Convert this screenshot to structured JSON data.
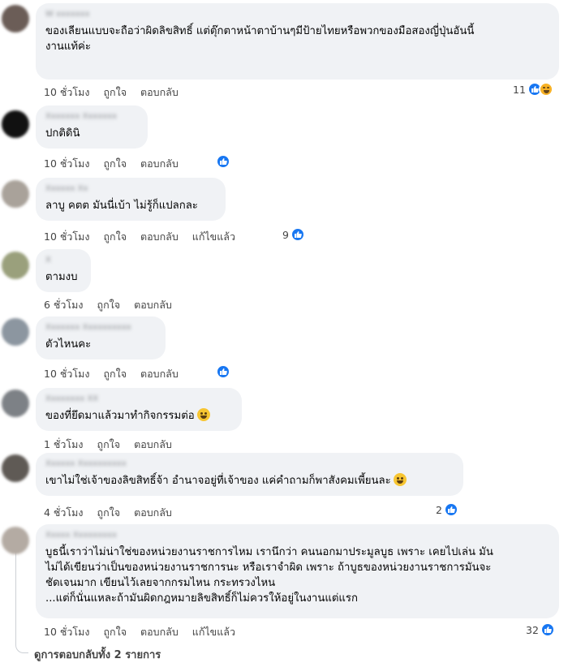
{
  "comments": [
    {
      "author": "W xxxxxxx",
      "lines": [
        "ของเลียนแบบจะถือว่าผิดลิขสิทธิ์ แต่ตุ๊กตาหน้าตาบ้านๆมีป้ายไทยหรือพวกของมือสองญี่ปุ่นอันนี้",
        "งานแท้ค่ะ"
      ],
      "time": "10 ชั่วโมง",
      "like": "ถูกใจ",
      "reply": "ตอบกลับ",
      "edited": "",
      "reaction_count": "11",
      "reactions": [
        "like",
        "haha"
      ],
      "emoji": ""
    },
    {
      "author": "Xxxxxxx Xxxxxxx",
      "lines": [
        "ปกติดินิ"
      ],
      "time": "10 ชั่วโมง",
      "like": "ถูกใจ",
      "reply": "ตอบกลับ",
      "edited": "",
      "reaction_count": "",
      "reactions": [
        "like"
      ],
      "emoji": ""
    },
    {
      "author": "Xxxxxx Xx",
      "lines": [
        "ลาบู คตต มันนี่เบ้า ไม่รู้ก็แปลกละ"
      ],
      "time": "10 ชั่วโมง",
      "like": "ถูกใจ",
      "reply": "ตอบกลับ",
      "edited": "แก้ไขแล้ว",
      "reaction_count": "9",
      "reactions": [
        "like"
      ],
      "emoji": ""
    },
    {
      "author": "X",
      "lines": [
        "ตามงบ"
      ],
      "time": "6 ชั่วโมง",
      "like": "ถูกใจ",
      "reply": "ตอบกลับ",
      "edited": "",
      "reaction_count": "",
      "reactions": [],
      "emoji": ""
    },
    {
      "author": "Xxxxxxx Xxxxxxxxxx",
      "lines": [
        "ตัวไหนคะ"
      ],
      "time": "10 ชั่วโมง",
      "like": "ถูกใจ",
      "reply": "ตอบกลับ",
      "edited": "",
      "reaction_count": "",
      "reactions": [
        "like"
      ],
      "emoji": ""
    },
    {
      "author": "Xxxxxxxx XX",
      "lines": [
        "ของที่ยึดมาแล้วมาทำกิจกรรมต่อ"
      ],
      "time": "1 ชั่วโมง",
      "like": "ถูกใจ",
      "reply": "ตอบกลับ",
      "edited": "",
      "reaction_count": "",
      "reactions": [],
      "emoji": "grin"
    },
    {
      "author": "Xxxxxx Xxxxxxxxxx",
      "lines": [
        "เขาไม่ใช่เจ้าของลิขสิทธิ์จ้า อำนาจอยู่ที่เจ้าของ แค่คำถามก็พาสังคมเพี้ยนละ"
      ],
      "time": "4 ชั่วโมง",
      "like": "ถูกใจ",
      "reply": "ตอบกลับ",
      "edited": "",
      "reaction_count": "2",
      "reactions": [
        "like"
      ],
      "emoji": "laugh"
    },
    {
      "author": "Xxxxx Xxxxxxxxx",
      "lines": [
        "บูธนี้เราว่าไม่น่าใช่ของหน่วยงานราชการไหม เรานึกว่า คนนอกมาประมูลบูธ เพราะ เคยไปเล่น มัน",
        "ไม่ได้เขียนว่าเป็นของหน่วยงานราชการนะ หรือเราจำผิด เพราะ ถ้าบูธของหน่วยงานราชการมันจะ",
        "ชัดเจนมาก เขียนไว้เลยจากกรมไหน กระทรวงไหน",
        "...แต่ก็นั่นแหละถ้ามันผิดกฎหมายลิขสิทธิ์ก็ไม่ควรให้อยู่ในงานแต่แรก"
      ],
      "time": "10 ชั่วโมง",
      "like": "ถูกใจ",
      "reply": "ตอบกลับ",
      "edited": "แก้ไขแล้ว",
      "reaction_count": "32",
      "reactions": [
        "like"
      ],
      "emoji": ""
    }
  ],
  "view_replies": "ดูการตอบกลับทั้ง 2 รายการ",
  "colors": {
    "bubble": "#f0f2f5",
    "like_blue": "#1877f2",
    "muted": "#65676b"
  }
}
